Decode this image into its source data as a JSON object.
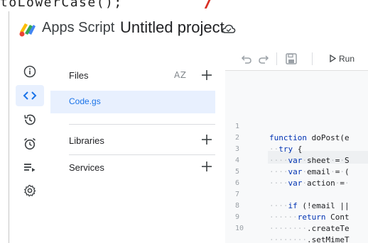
{
  "top_fragment": {
    "text": "toLowerCase();"
  },
  "header": {
    "app_name": "Apps Script",
    "project_title": "Untitled project",
    "logo_icon": "apps-script-logo",
    "cloud_icon": "cloud-saved-icon"
  },
  "rail": {
    "items": [
      {
        "icon": "info-icon",
        "active": false
      },
      {
        "icon": "code-brackets-icon",
        "active": true
      },
      {
        "icon": "history-icon",
        "active": false
      },
      {
        "icon": "alarm-clock-icon",
        "active": false
      },
      {
        "icon": "executions-icon",
        "active": false
      },
      {
        "icon": "settings-gear-icon",
        "active": false
      }
    ]
  },
  "files_panel": {
    "files_label": "Files",
    "sort_label": "AZ",
    "selected_file": "Code.gs",
    "libraries_label": "Libraries",
    "services_label": "Services"
  },
  "toolbar": {
    "run_label": "Run"
  },
  "editor": {
    "lines": [
      {
        "n": "1",
        "code": "function doPost(e"
      },
      {
        "n": "2",
        "code": "··try {"
      },
      {
        "n": "3",
        "code": "····var·sheet·=·S"
      },
      {
        "n": "4",
        "code": "····var·email·=·("
      },
      {
        "n": "5",
        "code": "····var·action·=·"
      },
      {
        "n": "6",
        "code": ""
      },
      {
        "n": "7",
        "code": "····if (!email ||"
      },
      {
        "n": "8",
        "code": "······return Cont"
      },
      {
        "n": "9",
        "code": "········.createTe"
      },
      {
        "n": "10",
        "code": "········.setMimeT"
      }
    ]
  },
  "colors": {
    "accent": "#1a73e8",
    "selected_bg": "#e8f0fe",
    "editor_bg": "#f8f9fa",
    "keyword": "#0033b3"
  }
}
